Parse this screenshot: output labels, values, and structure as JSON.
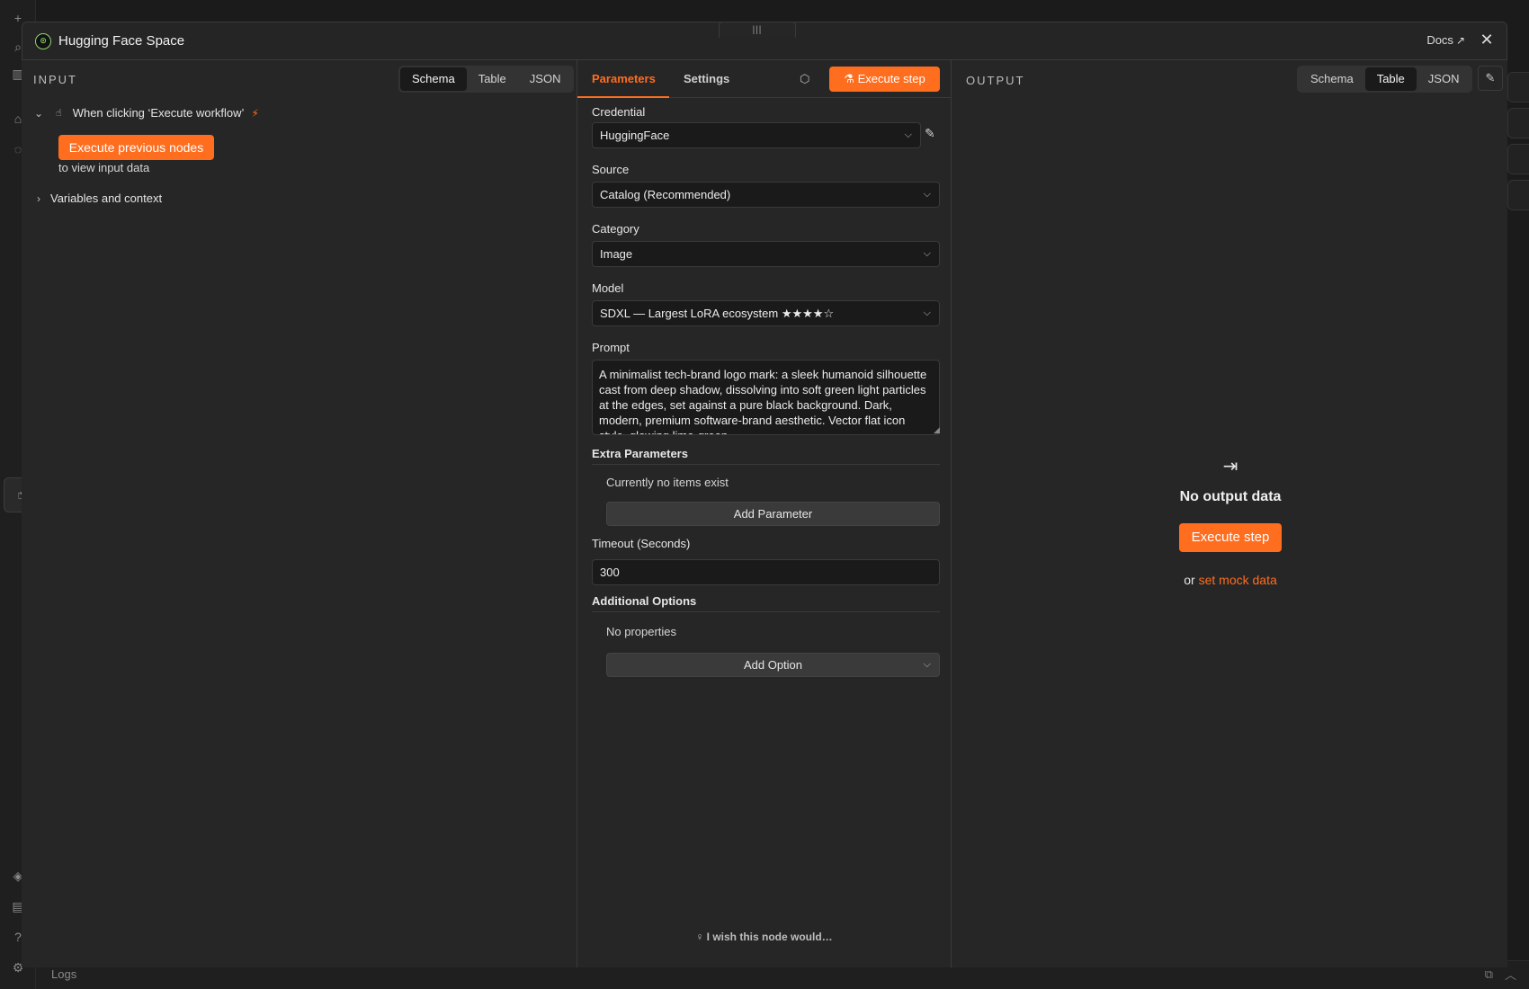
{
  "modal": {
    "title": "Hugging Face Space",
    "docs_label": "Docs",
    "close_icon": "close-icon"
  },
  "input": {
    "heading": "INPUT",
    "view_tabs": [
      "Schema",
      "Table",
      "JSON"
    ],
    "active_view": "Schema",
    "trigger_label": "When clicking ‘Execute workflow’",
    "exec_prev_label": "Execute previous nodes",
    "exec_prev_sub": "to view input data",
    "variables_label": "Variables and context"
  },
  "params": {
    "tabs": [
      "Parameters",
      "Settings"
    ],
    "active_tab": "Parameters",
    "execute_step_label": "Execute step",
    "credential": {
      "label": "Credential",
      "value": "HuggingFace"
    },
    "source": {
      "label": "Source",
      "value": "Catalog (Recommended)"
    },
    "category": {
      "label": "Category",
      "value": "Image"
    },
    "model": {
      "label": "Model",
      "value": "SDXL — Largest LoRA ecosystem ★★★★☆"
    },
    "prompt": {
      "label": "Prompt",
      "value": "A minimalist tech-brand logo mark: a sleek humanoid silhouette cast from deep shadow, dissolving into soft green light particles at the edges, set against a pure black background. Dark, modern, premium software-brand aesthetic. Vector flat icon style, glowing lime-green"
    },
    "extra": {
      "title": "Extra Parameters",
      "empty_note": "Currently no items exist",
      "add_label": "Add Parameter"
    },
    "timeout": {
      "label": "Timeout (Seconds)",
      "value": "300"
    },
    "additional": {
      "title": "Additional Options",
      "empty_note": "No properties",
      "add_label": "Add Option"
    },
    "wish_label": "I wish this node would…"
  },
  "output": {
    "heading": "OUTPUT",
    "view_tabs": [
      "Schema",
      "Table",
      "JSON"
    ],
    "active_view": "Table",
    "empty_title": "No output data",
    "execute_step_label": "Execute step",
    "or_text": "or",
    "mock_link": "set mock data"
  },
  "app": {
    "logs_label": "Logs"
  },
  "colors": {
    "accent": "#ff6d1f",
    "node_icon": "#8fd86e",
    "background": "#262626"
  }
}
